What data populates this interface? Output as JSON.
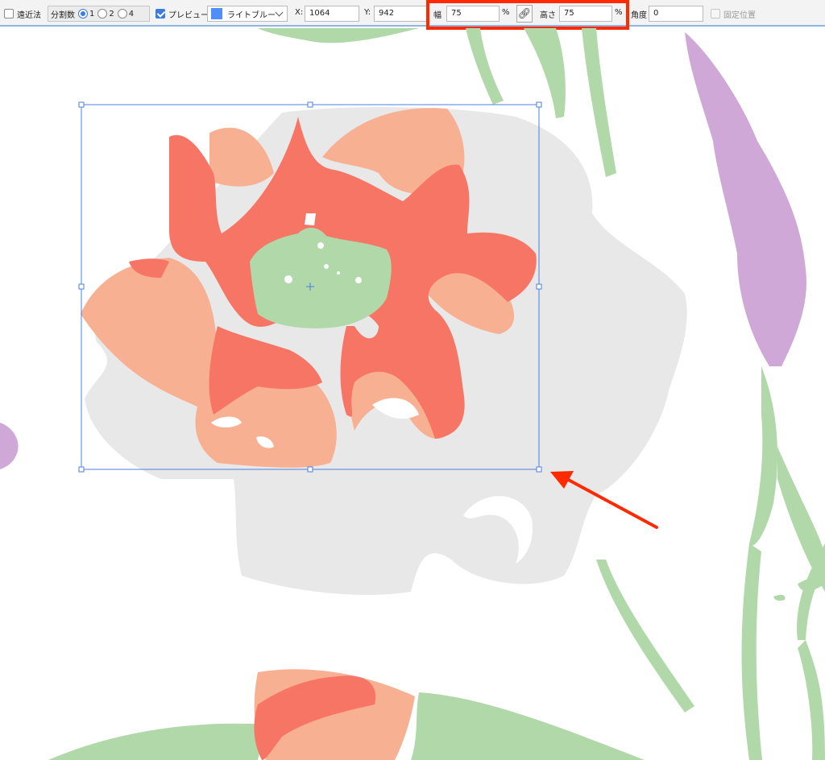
{
  "toolbar": {
    "perspective": {
      "label": "遠近法",
      "checked": false
    },
    "divisions": {
      "label": "分割数",
      "options": [
        "1",
        "2",
        "4"
      ],
      "selected": "1"
    },
    "preview": {
      "label": "プレビュー",
      "checked": true
    },
    "color_select": {
      "value": "ライトブルー",
      "swatch_color": "#4f8ff7"
    },
    "x": {
      "label": "X:",
      "value": "1064"
    },
    "y": {
      "label": "Y:",
      "value": "942"
    },
    "width": {
      "label": "幅",
      "value": "75",
      "unit": "%"
    },
    "link_icon": "chain-link-icon",
    "height": {
      "label": "高さ",
      "value": "75",
      "unit": "%"
    },
    "angle": {
      "label": "角度",
      "value": "0"
    },
    "fixed_position": {
      "label": "固定位置",
      "checked": false,
      "disabled": true
    }
  },
  "annotation": {
    "highlight_color": "#ff2a00",
    "arrow_color": "#ff2a00"
  },
  "colors": {
    "salmon_dark": "#f77564",
    "salmon_light": "#f8b092",
    "leaf_green": "#b0d8a8",
    "lavender": "#cfa8d8",
    "ghost_gray": "#e8e8e8",
    "selection_blue": "#4a7fe0"
  }
}
